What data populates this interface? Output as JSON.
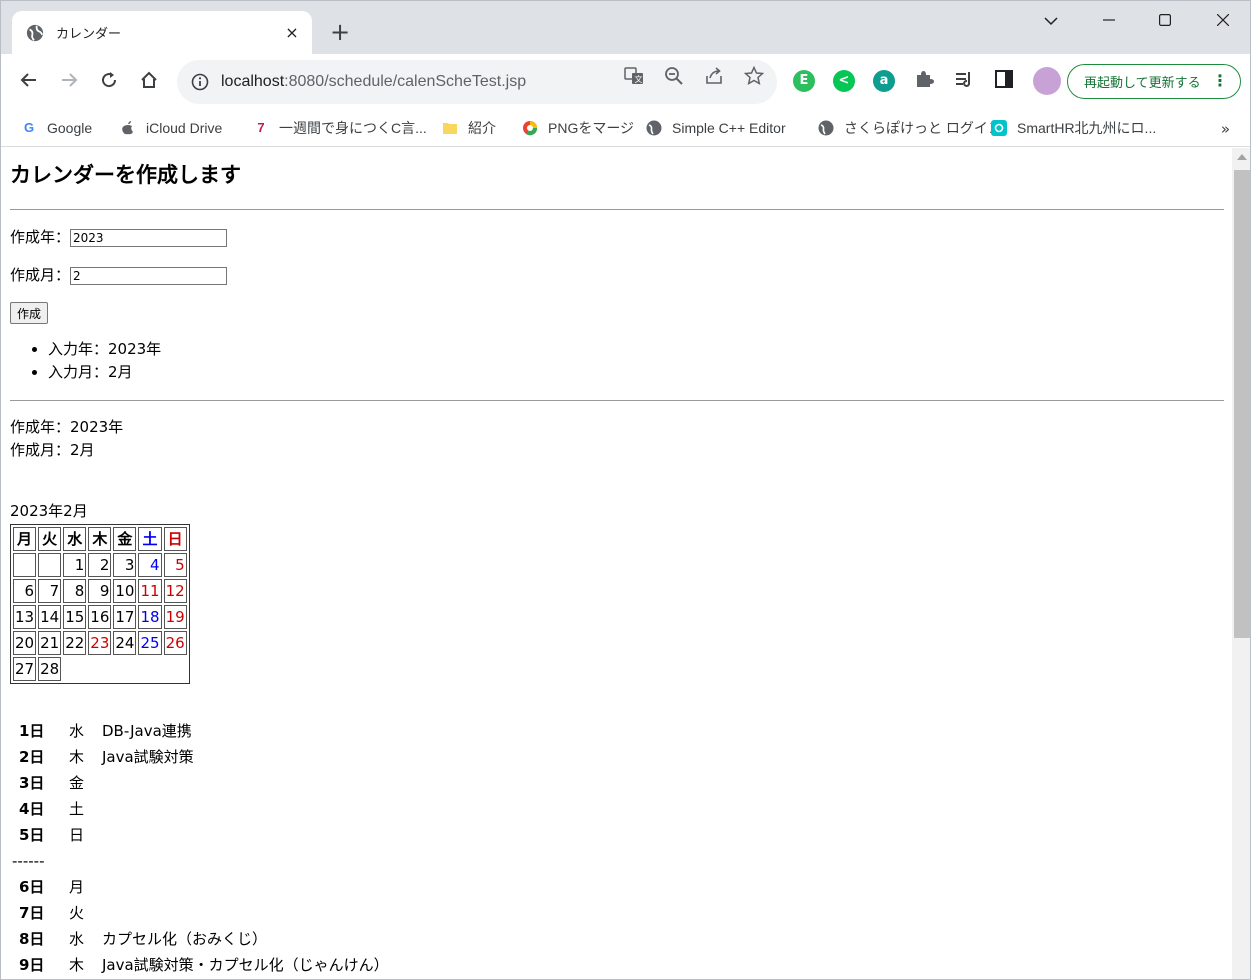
{
  "browser": {
    "tab_title": "カレンダー",
    "tab_close": "×",
    "new_tab": "+",
    "url_host": "localhost",
    "url_path": ":8080/schedule/calenScheTest.jsp",
    "restart_label": "再起動して更新する",
    "bookmarks": [
      {
        "label": "Google",
        "icon": "G",
        "color": "#4285f4"
      },
      {
        "label": "iCloud Drive",
        "icon": "",
        "color": "#5f6368"
      },
      {
        "label": "一週間で身につくC言...",
        "icon": "7",
        "color": "#c2185b"
      },
      {
        "label": "紹介",
        "icon": "",
        "color": "#f9d65c"
      },
      {
        "label": "PNGをマージ",
        "icon": "",
        "color": "#34a853"
      },
      {
        "label": "Simple C++ Editor",
        "icon": "",
        "color": "#5f6368"
      },
      {
        "label": "さくらぽけっと ログイン",
        "icon": "",
        "color": "#5f6368"
      },
      {
        "label": "SmartHR北九州にロ...",
        "icon": "",
        "color": "#00c4cc"
      }
    ],
    "bookmarks_more": "»"
  },
  "page": {
    "heading": "カレンダーを作成します",
    "year_label": "作成年：",
    "year_value": "2023",
    "month_label": "作成月：",
    "month_value": "2",
    "submit_label": "作成",
    "input_year": "入力年：2023年",
    "input_month": "入力月：2月",
    "created_year": "作成年：2023年",
    "created_month": "作成月：2月",
    "calendar_title": "2023年2月"
  },
  "calendar": {
    "headers": [
      "月",
      "火",
      "水",
      "木",
      "金",
      "土",
      "日"
    ],
    "weeks": [
      [
        "",
        "",
        "1",
        "2",
        "3",
        "4",
        "5"
      ],
      [
        "6",
        "7",
        "8",
        "9",
        "10",
        "11",
        "12"
      ],
      [
        "13",
        "14",
        "15",
        "16",
        "17",
        "18",
        "19"
      ],
      [
        "20",
        "21",
        "22",
        "23",
        "24",
        "25",
        "26"
      ],
      [
        "27",
        "28",
        "",
        "",
        "",
        "",
        ""
      ]
    ],
    "holidays": [
      "11",
      "23"
    ]
  },
  "schedule": [
    {
      "day": "1日",
      "weekday": "水",
      "text": "DB-Java連携"
    },
    {
      "day": "2日",
      "weekday": "木",
      "text": "Java試験対策"
    },
    {
      "day": "3日",
      "weekday": "金",
      "text": ""
    },
    {
      "day": "4日",
      "weekday": "土",
      "text": ""
    },
    {
      "day": "5日",
      "weekday": "日",
      "text": ""
    },
    {
      "separator": "------"
    },
    {
      "day": "6日",
      "weekday": "月",
      "text": ""
    },
    {
      "day": "7日",
      "weekday": "火",
      "text": ""
    },
    {
      "day": "8日",
      "weekday": "水",
      "text": "カプセル化（おみくじ）"
    },
    {
      "day": "9日",
      "weekday": "木",
      "text": "Java試験対策・カプセル化（じゃんけん）"
    }
  ]
}
